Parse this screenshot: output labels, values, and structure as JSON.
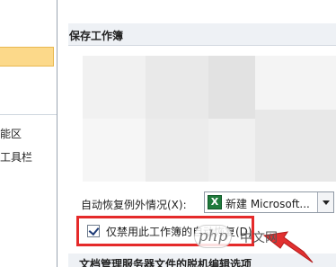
{
  "sidebar": {
    "items": [
      {
        "label": "能区"
      },
      {
        "label": "工具栏"
      }
    ]
  },
  "section": {
    "title": "保存工作簿",
    "next_title": "文档管理服务器文件的脱机编辑选项"
  },
  "autorecover": {
    "exception_label": "自动恢复例外情况(X):",
    "workbook_value": "新建 Microsoft...",
    "workbook_icon": "excel-icon",
    "disable_checkbox_label": "仅禁用此工作簿的自动恢复(D)",
    "disable_checked": true
  },
  "watermark": {
    "badge": "php",
    "text": "中文网"
  },
  "colors": {
    "highlight": "#e52a2a",
    "nav_selected": "#fcd98a"
  }
}
